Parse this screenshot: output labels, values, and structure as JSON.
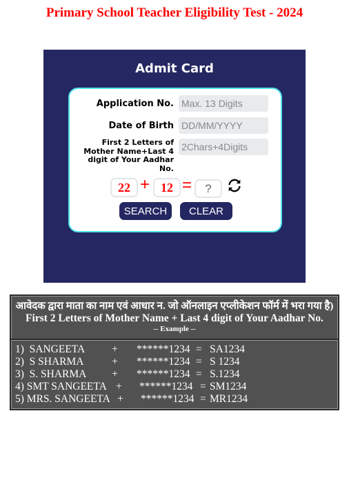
{
  "page": {
    "title": "Primary School Teacher Eligibility Test - 2024"
  },
  "admit_card": {
    "heading": "Admit Card",
    "fields": {
      "application_no": {
        "label": "Application No.",
        "value": "",
        "placeholder": "Max. 13 Digits"
      },
      "date_of_birth": {
        "label": "Date of Birth",
        "value": "",
        "placeholder": "DD/MM/YYYY"
      },
      "mother_aadhar": {
        "label": "First 2 Letters of Mother Name+Last 4 digit of Your Aadhar No.",
        "value": "",
        "placeholder": "2Chars+4Digits"
      }
    },
    "captcha": {
      "num1": "22",
      "operator": "+",
      "num2": "12",
      "equals": "=",
      "answer_value": "",
      "answer_placeholder": "?",
      "refresh_icon": "refresh-icon"
    },
    "buttons": {
      "search": "SEARCH",
      "clear": "CLEAR"
    },
    "colors": {
      "panel": "#252762",
      "card_border": "#4de6ee",
      "captcha_text": "#ff0000"
    }
  },
  "example_box": {
    "hindi_line": "आवेदक द्वारा माता का नाम  एवं आधार न. जो ऑनलाइन एप्लीकेशन फॉर्म में भरा गया है)",
    "english_line": "First 2 Letters of Mother Name + Last 4 digit of Your Aadhar No.",
    "example_label": "-- Example --",
    "rows": [
      {
        "name": "1)  SANGEETA",
        "plus": "+",
        "masked": "******1234",
        "eq": "=",
        "result": "SA1234"
      },
      {
        "name": "2)  S SHARMA",
        "plus": "+",
        "masked": "******1234",
        "eq": "=",
        "result": "S 1234"
      },
      {
        "name": "3)  S. SHARMA",
        "plus": "+",
        "masked": "******1234",
        "eq": "=",
        "result": "S.1234"
      },
      {
        "name": "4) SMT SANGEETA",
        "plus": "+",
        "masked": "******1234",
        "eq": "=",
        "result": "SM1234"
      },
      {
        "name": "5) MRS. SANGEETA",
        "plus": "+",
        "masked": "******1234",
        "eq": "=",
        "result": "MR1234"
      }
    ]
  }
}
